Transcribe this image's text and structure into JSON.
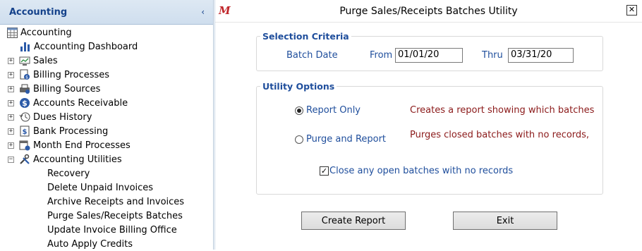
{
  "sidebar": {
    "title": "Accounting",
    "collapse_glyph": "‹",
    "root": {
      "label": "Accounting",
      "icon": "accounting-grid-icon"
    },
    "items": [
      {
        "label": "Accounting Dashboard",
        "icon": "bar-chart-icon",
        "expander": ""
      },
      {
        "label": "Sales",
        "icon": "sales-icon",
        "expander": "+"
      },
      {
        "label": "Billing Processes",
        "icon": "billing-processes-icon",
        "expander": "+"
      },
      {
        "label": "Billing Sources",
        "icon": "billing-sources-icon",
        "expander": "+"
      },
      {
        "label": "Accounts Receivable",
        "icon": "dollar-circle-icon",
        "expander": "+"
      },
      {
        "label": "Dues History",
        "icon": "history-icon",
        "expander": "+"
      },
      {
        "label": "Bank Processing",
        "icon": "bank-icon",
        "expander": "+"
      },
      {
        "label": "Month End Processes",
        "icon": "month-end-icon",
        "expander": "+"
      },
      {
        "label": "Accounting Utilities",
        "icon": "tools-icon",
        "expander": "−"
      }
    ],
    "sub_items": [
      "Recovery",
      "Delete Unpaid Invoices",
      "Archive Receipts and Invoices",
      "Purge Sales/Receipts Batches",
      "Update Invoice Billing Office",
      "Auto Apply Credits"
    ]
  },
  "dialog": {
    "logo": "M",
    "title": "Purge Sales/Receipts Batches Utility",
    "close_glyph": "✕",
    "selection": {
      "legend": "Selection Criteria",
      "batch_date_label": "Batch Date",
      "from_label": "From",
      "from_value": "01/01/20",
      "thru_label": "Thru",
      "thru_value": "03/31/20"
    },
    "options": {
      "legend": "Utility Options",
      "report_only_label": "Report Only",
      "report_only_desc": "Creates a report showing which batches",
      "purge_label": "Purge and Report",
      "purge_desc": "Purges closed batches with no records,",
      "close_open_label": "Close any open batches with no records",
      "selected": "report_only",
      "close_open_checked": true
    },
    "buttons": {
      "create_report": "Create Report",
      "exit": "Exit"
    }
  },
  "colors": {
    "label_blue": "#1f4e9c",
    "desc_red": "#8b1a1a",
    "sidebar_header_text": "#15428b"
  }
}
